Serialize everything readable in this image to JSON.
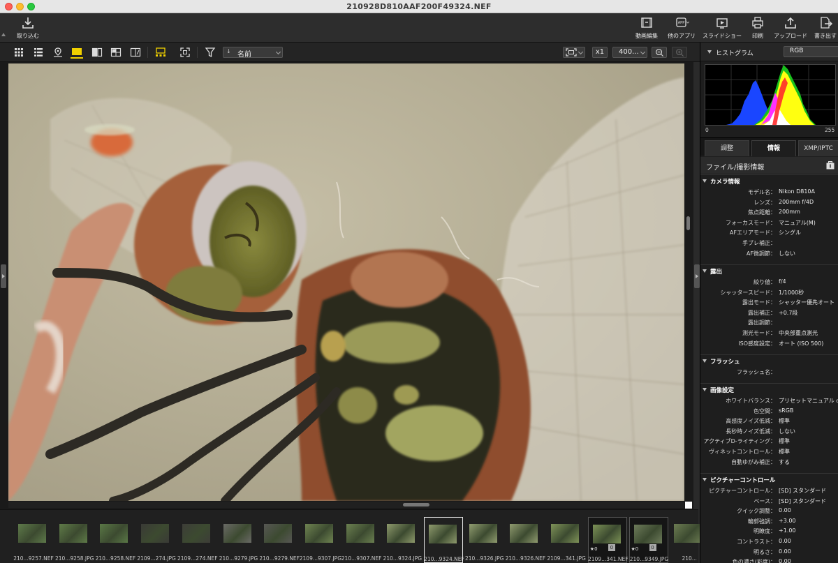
{
  "window": {
    "title": "210928D810AAF200F49324.NEF"
  },
  "toolbar": {
    "import_label": "取り込む",
    "movie_label": "動画編集",
    "apps_label": "他のアプリ",
    "slideshow_label": "スライドショー",
    "print_label": "印刷",
    "upload_label": "アップロード",
    "export_label": "書き出す",
    "app_badge": "APP"
  },
  "subbar": {
    "sort_label": "名前",
    "zoom_multiplier": "x1",
    "zoom_value": "400..."
  },
  "histogram": {
    "title": "ヒストグラム",
    "channel": "RGB",
    "min": "0",
    "max": "255"
  },
  "tabs": [
    "調整",
    "情報",
    "XMP/IPTC"
  ],
  "info_title": "ファイル/撮影情報",
  "groups": {
    "camera": {
      "title": "カメラ情報",
      "rows": [
        {
          "k": "モデル名：",
          "v": "Nikon D810A"
        },
        {
          "k": "レンズ：",
          "v": "200mm f/4D"
        },
        {
          "k": "焦点距離：",
          "v": "200mm"
        },
        {
          "k": "フォーカスモード：",
          "v": "マニュアル(M)"
        },
        {
          "k": "AFエリアモード：",
          "v": "シングル"
        },
        {
          "k": "手ブレ補正：",
          "v": ""
        },
        {
          "k": "AF微調節：",
          "v": "しない"
        }
      ]
    },
    "exposure": {
      "title": "露出",
      "rows": [
        {
          "k": "絞り値：",
          "v": "f/4"
        },
        {
          "k": "シャッタースピード：",
          "v": "1/1000秒"
        },
        {
          "k": "露出モード：",
          "v": "シャッター優先オート"
        },
        {
          "k": "露出補正：",
          "v": "+0.7段"
        },
        {
          "k": "露出調節：",
          "v": ""
        },
        {
          "k": "測光モード：",
          "v": "中央部重点測光"
        },
        {
          "k": "ISO感度設定：",
          "v": "オート (ISO 500)"
        }
      ]
    },
    "flash": {
      "title": "フラッシュ",
      "rows": [
        {
          "k": "フラッシュ名：",
          "v": ""
        }
      ]
    },
    "image": {
      "title": "画像設定",
      "rows": [
        {
          "k": "ホワイトバランス：",
          "v": "プリセットマニュアル d-"
        },
        {
          "k": "色空間：",
          "v": "sRGB"
        },
        {
          "k": "高感度ノイズ低減：",
          "v": "標準"
        },
        {
          "k": "長秒時ノイズ低減：",
          "v": "しない"
        },
        {
          "k": "アクティブD-ライティング：",
          "v": "標準"
        },
        {
          "k": "ヴィネットコントロール：",
          "v": "標準"
        },
        {
          "k": "自動ゆがみ補正：",
          "v": "する"
        }
      ]
    },
    "picture": {
      "title": "ピクチャーコントロール",
      "rows": [
        {
          "k": "ピクチャーコントロール：",
          "v": "[SD] スタンダード"
        },
        {
          "k": "ベース：",
          "v": "[SD] スタンダード"
        },
        {
          "k": "クイック調整：",
          "v": "0.00"
        },
        {
          "k": "輪郭強調：",
          "v": "+3.00"
        },
        {
          "k": "明瞭度：",
          "v": "+1.00"
        },
        {
          "k": "コントラスト：",
          "v": "0.00"
        },
        {
          "k": "明るさ：",
          "v": "0.00"
        },
        {
          "k": "色の濃さ(彩度)：",
          "v": "0.00"
        }
      ]
    }
  },
  "filmstrip": [
    {
      "label": "210...9257.NEF",
      "tone": "#5e7a4a"
    },
    {
      "label": "210...9258.JPG",
      "tone": "#5f7b48"
    },
    {
      "label": "210...9258.NEF",
      "tone": "#5a7846"
    },
    {
      "label": "2109...274.JPG",
      "tone": "#3a3a36"
    },
    {
      "label": "2109...274.NEF",
      "tone": "#3d3d38"
    },
    {
      "label": "210...9279.JPG",
      "tone": "#6a6a66"
    },
    {
      "label": "210...9279.NEF",
      "tone": "#575754"
    },
    {
      "label": "2109...9307.JPG",
      "tone": "#6f8451"
    },
    {
      "label": "210...9307.NEF",
      "tone": "#6b8050"
    },
    {
      "label": "210...9324.JPG",
      "tone": "#8e9a6c"
    },
    {
      "label": "210...9324.NEF",
      "tone": "#8f9b6d"
    },
    {
      "label": "210...9326.JPG",
      "tone": "#919d70"
    },
    {
      "label": "210...9326.NEF",
      "tone": "#909b6f"
    },
    {
      "label": "2109...341.JPG",
      "tone": "#7f9358"
    },
    {
      "label": "2109...341.NEF",
      "tone": "#7c9256",
      "star": "★0",
      "badge": "0"
    },
    {
      "label": "210...9349.JPG",
      "tone": "#6d7b5a",
      "star": "★0",
      "badge": "0"
    },
    {
      "label": "210...",
      "tone": "#6c7c52"
    }
  ]
}
